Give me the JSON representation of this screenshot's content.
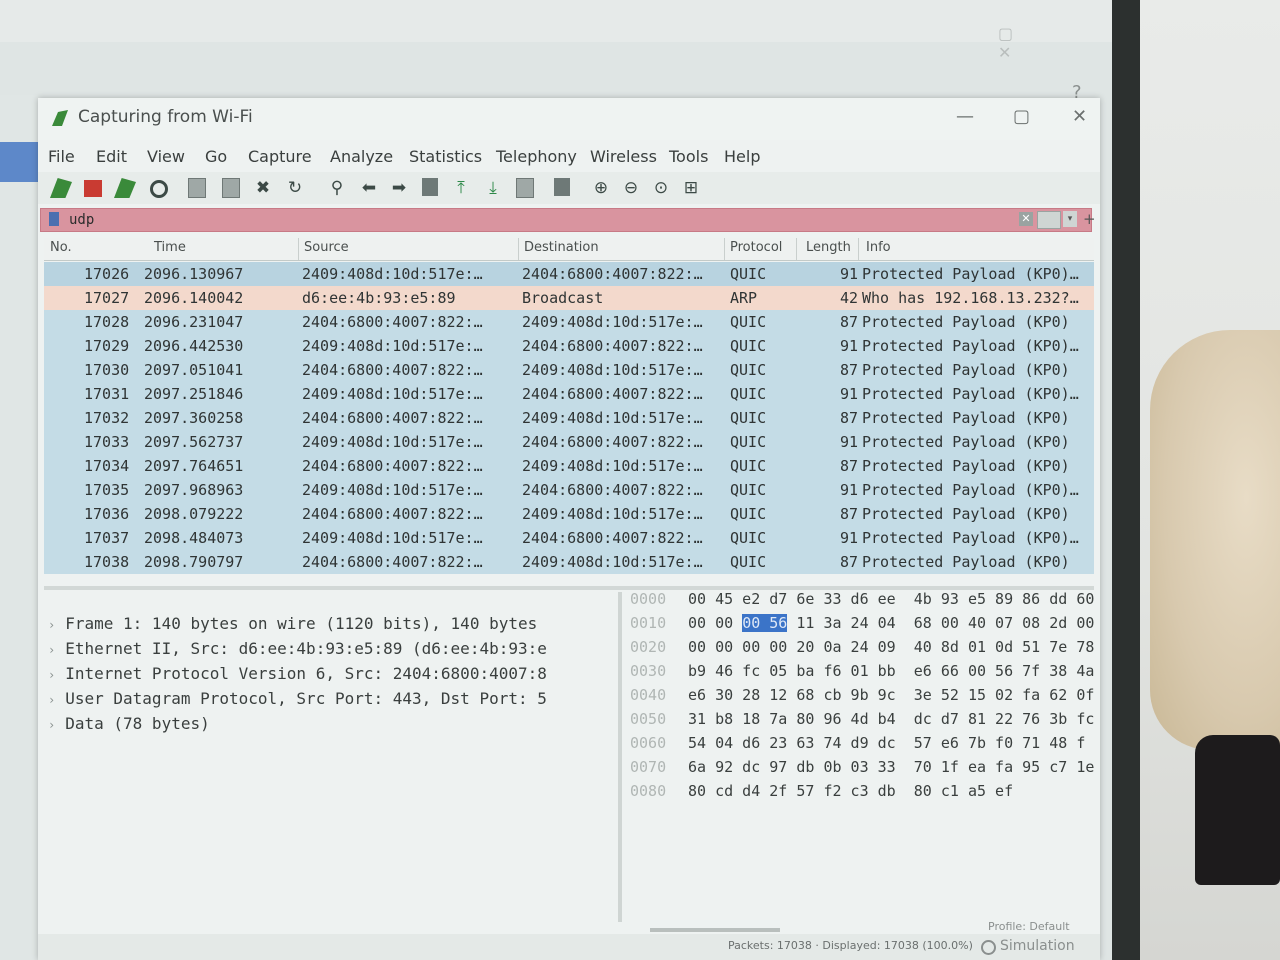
{
  "window": {
    "title": "Capturing from Wi-Fi",
    "help_glyph": "?"
  },
  "menu": [
    "File",
    "Edit",
    "View",
    "Go",
    "Capture",
    "Analyze",
    "Statistics",
    "Telephony",
    "Wireless",
    "Tools",
    "Help"
  ],
  "filter": {
    "value": "udp"
  },
  "columns": [
    "No.",
    "Time",
    "Source",
    "Destination",
    "Protocol",
    "Length",
    "Info"
  ],
  "packets": [
    {
      "no": "17026",
      "time": "2096.130967",
      "src": "2409:408d:10d:517e:…",
      "dst": "2404:6800:4007:822:…",
      "proto": "QUIC",
      "len": "91",
      "info": "Protected Payload (KP0)…",
      "kind": "quic"
    },
    {
      "no": "17027",
      "time": "2096.140042",
      "src": "d6:ee:4b:93:e5:89",
      "dst": "Broadcast",
      "proto": "ARP",
      "len": "42",
      "info": "Who has 192.168.13.232?…",
      "kind": "arp"
    },
    {
      "no": "17028",
      "time": "2096.231047",
      "src": "2404:6800:4007:822:…",
      "dst": "2409:408d:10d:517e:…",
      "proto": "QUIC",
      "len": "87",
      "info": "Protected Payload (KP0)",
      "kind": "quic"
    },
    {
      "no": "17029",
      "time": "2096.442530",
      "src": "2409:408d:10d:517e:…",
      "dst": "2404:6800:4007:822:…",
      "proto": "QUIC",
      "len": "91",
      "info": "Protected Payload (KP0)…",
      "kind": "quic"
    },
    {
      "no": "17030",
      "time": "2097.051041",
      "src": "2404:6800:4007:822:…",
      "dst": "2409:408d:10d:517e:…",
      "proto": "QUIC",
      "len": "87",
      "info": "Protected Payload (KP0)",
      "kind": "quic"
    },
    {
      "no": "17031",
      "time": "2097.251846",
      "src": "2409:408d:10d:517e:…",
      "dst": "2404:6800:4007:822:…",
      "proto": "QUIC",
      "len": "91",
      "info": "Protected Payload (KP0)…",
      "kind": "quic"
    },
    {
      "no": "17032",
      "time": "2097.360258",
      "src": "2404:6800:4007:822:…",
      "dst": "2409:408d:10d:517e:…",
      "proto": "QUIC",
      "len": "87",
      "info": "Protected Payload (KP0)",
      "kind": "quic"
    },
    {
      "no": "17033",
      "time": "2097.562737",
      "src": "2409:408d:10d:517e:…",
      "dst": "2404:6800:4007:822:…",
      "proto": "QUIC",
      "len": "91",
      "info": "Protected Payload (KP0)",
      "kind": "quic"
    },
    {
      "no": "17034",
      "time": "2097.764651",
      "src": "2404:6800:4007:822:…",
      "dst": "2409:408d:10d:517e:…",
      "proto": "QUIC",
      "len": "87",
      "info": "Protected Payload (KP0)",
      "kind": "quic"
    },
    {
      "no": "17035",
      "time": "2097.968963",
      "src": "2409:408d:10d:517e:…",
      "dst": "2404:6800:4007:822:…",
      "proto": "QUIC",
      "len": "91",
      "info": "Protected Payload (KP0)…",
      "kind": "quic"
    },
    {
      "no": "17036",
      "time": "2098.079222",
      "src": "2404:6800:4007:822:…",
      "dst": "2409:408d:10d:517e:…",
      "proto": "QUIC",
      "len": "87",
      "info": "Protected Payload (KP0)",
      "kind": "quic"
    },
    {
      "no": "17037",
      "time": "2098.484073",
      "src": "2409:408d:10d:517e:…",
      "dst": "2404:6800:4007:822:…",
      "proto": "QUIC",
      "len": "91",
      "info": "Protected Payload (KP0)…",
      "kind": "quic"
    },
    {
      "no": "17038",
      "time": "2098.790797",
      "src": "2404:6800:4007:822:…",
      "dst": "2409:408d:10d:517e:…",
      "proto": "QUIC",
      "len": "87",
      "info": "Protected Payload (KP0)",
      "kind": "quic"
    }
  ],
  "details": [
    "Frame 1: 140 bytes on wire (1120 bits), 140 bytes",
    "Ethernet II, Src: d6:ee:4b:93:e5:89 (d6:ee:4b:93:e",
    "Internet Protocol Version 6, Src: 2404:6800:4007:8",
    "User Datagram Protocol, Src Port: 443, Dst Port: 5",
    "Data (78 bytes)"
  ],
  "bytes": [
    {
      "off": "0000",
      "pre": "00 45 e2 d7 6e 33 d6 ee  4b 93 e5 89 86 dd 60",
      "hl": "",
      "post": ""
    },
    {
      "off": "0010",
      "pre": "00 00 ",
      "hl": "00 56",
      "post": " 11 3a 24 04  68 00 40 07 08 2d 00"
    },
    {
      "off": "0020",
      "pre": "00 00 00 00 20 0a 24 09  40 8d 01 0d 51 7e 78",
      "hl": "",
      "post": ""
    },
    {
      "off": "0030",
      "pre": "b9 46 fc 05 ba f6 01 bb  e6 66 00 56 7f 38 4a",
      "hl": "",
      "post": ""
    },
    {
      "off": "0040",
      "pre": "e6 30 28 12 68 cb 9b 9c  3e 52 15 02 fa 62 0f",
      "hl": "",
      "post": ""
    },
    {
      "off": "0050",
      "pre": "31 b8 18 7a 80 96 4d b4  dc d7 81 22 76 3b fc",
      "hl": "",
      "post": ""
    },
    {
      "off": "0060",
      "pre": "54 04 d6 23 63 74 d9 dc  57 e6 7b f0 71 48 f",
      "hl": "",
      "post": ""
    },
    {
      "off": "0070",
      "pre": "6a 92 dc 97 db 0b 03 33  70 1f ea fa 95 c7 1e",
      "hl": "",
      "post": ""
    },
    {
      "off": "0080",
      "pre": "80 cd d4 2f 57 f2 c3 db  80 c1 a5 ef",
      "hl": "",
      "post": ""
    }
  ],
  "status": {
    "text": "Packets: 17038 · Displayed: 17038 (100.0%)",
    "profile": "Profile: Default",
    "mode": "Simulation"
  },
  "colors": {
    "quic_row": "#c4dce6",
    "arp_row": "#f3d9cc",
    "filter_bg": "#d9949f",
    "byte_highlight": "#3b74c8"
  },
  "icons": [
    "shark-fin-icon",
    "stop-icon",
    "restart-icon",
    "options-gear-icon",
    "open-file-icon",
    "save-file-icon",
    "close-file-icon",
    "reload-icon",
    "find-icon",
    "go-back-icon",
    "go-forward-icon",
    "go-to-packet-icon",
    "first-packet-icon",
    "last-packet-icon",
    "autoscroll-icon",
    "colorize-icon",
    "zoom-in-icon",
    "zoom-out-icon",
    "normal-size-icon",
    "resize-columns-icon"
  ]
}
